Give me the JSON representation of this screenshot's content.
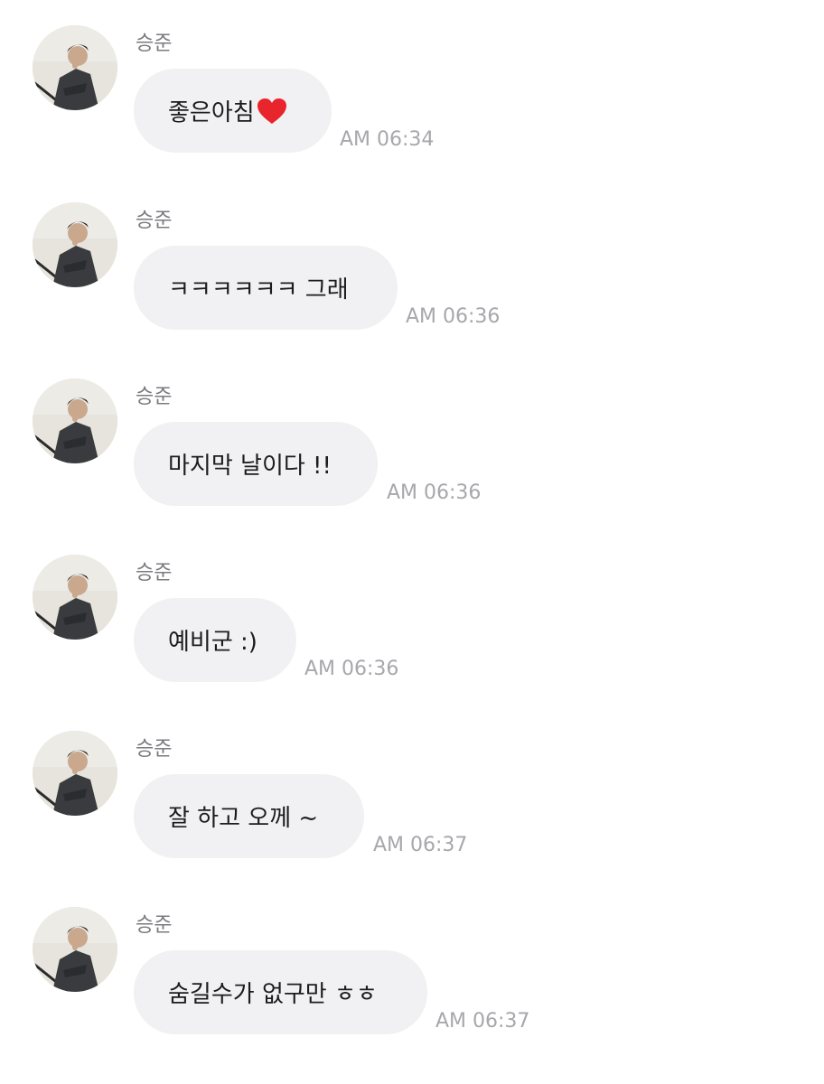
{
  "chat": {
    "messages": [
      {
        "sender": "승준",
        "text": "좋은아침",
        "emoji": "heart",
        "time": "AM 06:34"
      },
      {
        "sender": "승준",
        "text": "ㅋㅋㅋㅋㅋㅋ 그래",
        "time": "AM 06:36"
      },
      {
        "sender": "승준",
        "text": "마지막 날이다 !!",
        "time": "AM 06:36"
      },
      {
        "sender": "승준",
        "text": "예비군 :)",
        "time": "AM 06:36"
      },
      {
        "sender": "승준",
        "text": "잘 하고 오께 ~",
        "time": "AM 06:37"
      },
      {
        "sender": "승준",
        "text": "숨길수가 없구만 ㅎㅎ",
        "time": "AM 06:37"
      }
    ]
  },
  "colors": {
    "bubble": "#f1f1f4",
    "sender": "#7b7b80",
    "timestamp": "#a7a7ac",
    "heart": "#e8242c"
  }
}
